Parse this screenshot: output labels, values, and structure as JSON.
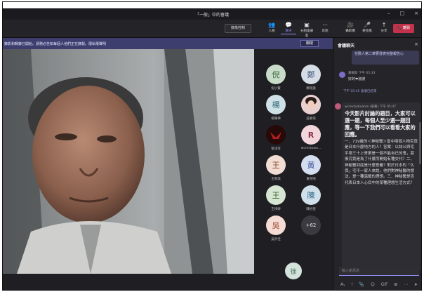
{
  "window": {
    "title": "「一般」中的會議",
    "controls": [
      "–",
      "□",
      "×"
    ]
  },
  "toolbar": {
    "control_button": "錄像控制",
    "items": [
      {
        "icon": "people-icon",
        "glyph": "👥",
        "label": "人員"
      },
      {
        "icon": "chat-icon",
        "glyph": "💬",
        "label": "聊天"
      },
      {
        "icon": "breakout-icon",
        "glyph": "▣",
        "label": "分組會議室"
      },
      {
        "icon": "more-icon",
        "glyph": "⋯",
        "label": "其他"
      },
      {
        "icon": "camera-icon",
        "glyph": "🎥",
        "label": "攝影機"
      },
      {
        "icon": "mic-icon",
        "glyph": "🎤",
        "label": "麥克風"
      },
      {
        "icon": "share-icon",
        "glyph": "↑",
        "label": "分享"
      }
    ],
    "leave_label": "📞 離開"
  },
  "banner": {
    "text": "錄影和轉錄已開始。請務必告知每個人他們正在錄製。隱私權聲明",
    "close": "關閉"
  },
  "roster": [
    {
      "initial": "倪",
      "name": "倪小賢",
      "bg": "#c9dbc9",
      "fg": "#3c6b3c"
    },
    {
      "initial": "鄭",
      "name": "鄭翔蓮",
      "bg": "#d6dde7",
      "fg": "#41587a"
    },
    {
      "initial": "楊",
      "name": "楊曜樺",
      "bg": "#cfe1e6",
      "fg": "#2f6777"
    },
    {
      "initial": "",
      "name": "吳敏琪",
      "bg": "#d8b7b7",
      "fg": "#5a2a2a"
    },
    {
      "initial": "",
      "name": "張洋等",
      "bg": "#3b1414",
      "fg": "#c33"
    },
    {
      "initial": "R",
      "name": "wcmstudio...",
      "bg": "#f2d6dc",
      "fg": "#8a2f45"
    },
    {
      "initial": "王",
      "name": "王珮琪",
      "bg": "#f1ddd3",
      "fg": "#8a4a2f"
    },
    {
      "initial": "黃",
      "name": "黃育晴",
      "bg": "#d5ddf0",
      "fg": "#3f5598"
    },
    {
      "initial": "王",
      "name": "王梓婷",
      "bg": "#d7e6d3",
      "fg": "#3f6a37"
    },
    {
      "initial": "陳",
      "name": "陳怡瑩",
      "bg": "#cfe0ea",
      "fg": "#2e6485"
    },
    {
      "initial": "吳",
      "name": "吳祈佳",
      "bg": "#f5dcd4",
      "fg": "#9c4b33"
    },
    {
      "initial": "+62",
      "name": "",
      "bg": "#3a3a40",
      "fg": "#e0e0e0"
    },
    {
      "initial": "徐",
      "name": "",
      "bg": "#d4e3dc",
      "fg": "#3d6b57"
    }
  ],
  "chat": {
    "header": "會議聊天",
    "bubble1": "任歡人第二章要發表完整報告心",
    "msg1_sender": "黃敏斯 下午 05:33",
    "msg1_text": "好的❤謝謝",
    "system_note": "下午 05:45  會議已結束",
    "msg2_sender": "wcmstudioahm (來賓) 下午 05:47",
    "msg2_big": "今天影片討論的題目，大家可以選一題，每個人至少選一題回應，等一下我們可以看看大家的回應。",
    "msg2_small": "一、719歲的＜神秘醫＞當中兩個人物究竟是日本什麼地方的人？答案：以誌公與宅平常三十上哥更是一個不能自已的鬼，甚後究竟是為了什麼而開始有種交代？二、神秘醫到底是什麼意義？對於日本的「久保」宅平一家人來說，他們對神秘醫的想法，是一種溫暖的理想。三、神秘醫是否代表日本人心目中的某種理想生活方式？",
    "composer_placeholder": "輸入新訊息",
    "composer_tools": [
      "Aᵧ",
      "!",
      "📎",
      "☺",
      "GIF",
      "⊞",
      "⋯",
      "➤"
    ]
  }
}
